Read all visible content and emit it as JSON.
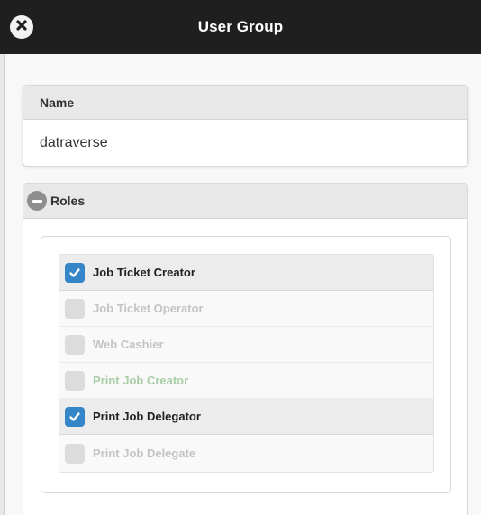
{
  "header": {
    "title": "User Group"
  },
  "name_panel": {
    "heading": "Name",
    "value": "datraverse"
  },
  "roles_panel": {
    "heading": "Roles",
    "roles": [
      {
        "label": "Job Ticket Creator",
        "checked": true,
        "state": "checked"
      },
      {
        "label": "Job Ticket Operator",
        "checked": false,
        "state": "unchecked"
      },
      {
        "label": "Web Cashier",
        "checked": false,
        "state": "unchecked"
      },
      {
        "label": "Print Job Creator",
        "checked": false,
        "state": "unchecked-green"
      },
      {
        "label": "Print Job Delegator",
        "checked": true,
        "state": "checked"
      },
      {
        "label": "Print Job Delegate",
        "checked": false,
        "state": "unchecked"
      }
    ]
  },
  "colors": {
    "header_bg": "#1f1f1f",
    "checkbox_checked": "#3486c8",
    "checkbox_unchecked": "#dcdcdc",
    "label_disabled": "#c4c4c4",
    "label_green": "#a8cda8"
  }
}
